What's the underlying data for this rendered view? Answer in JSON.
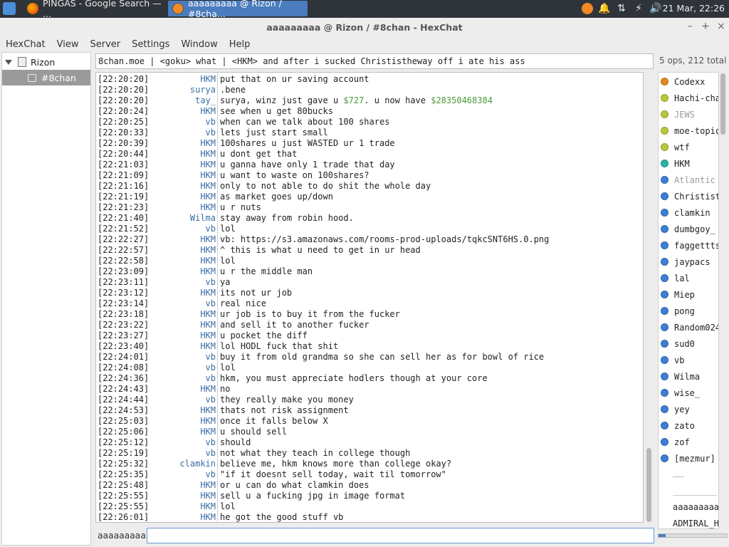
{
  "taskbar": {
    "tasks": [
      {
        "label": "PINGAS - Google Search — ..."
      },
      {
        "label": "aaaaaaaaa @ Rizon / #8cha..."
      }
    ],
    "clock": "21 Mar, 22:26"
  },
  "window": {
    "title": "aaaaaaaaa @ Rizon / #8chan - HexChat",
    "min": "–",
    "max": "+",
    "close": "×"
  },
  "menu": [
    "HexChat",
    "View",
    "Server",
    "Settings",
    "Window",
    "Help"
  ],
  "tree": {
    "server": "Rizon",
    "channel": "#8chan"
  },
  "topic": "8chan.moe | <goku> what | <HKM> and after i sucked Christistheway off i ate his ass",
  "ops_count": "5 ops, 212 total",
  "messages": [
    {
      "time": "[22:20:20]",
      "nick": "HKM",
      "text": "put that on ur saving account"
    },
    {
      "time": "[22:20:20]",
      "nick": "surya",
      "text": ".bene"
    },
    {
      "time": "[22:20:20]",
      "nick": "tay_",
      "text": "surya, winz just gave u ",
      "money1": "$727",
      "text2": ". u now have ",
      "money2": "$28350468384"
    },
    {
      "time": "[22:20:24]",
      "nick": "HKM",
      "text": "see when u get 80bucks"
    },
    {
      "time": "[22:20:25]",
      "nick": "vb",
      "text": "when can we talk about 100 shares"
    },
    {
      "time": "[22:20:33]",
      "nick": "vb",
      "text": "lets just start small"
    },
    {
      "time": "[22:20:39]",
      "nick": "HKM",
      "text": "100shares u just WASTED ur 1 trade"
    },
    {
      "time": "[22:20:44]",
      "nick": "HKM",
      "text": "u dont get that"
    },
    {
      "time": "[22:21:03]",
      "nick": "HKM",
      "text": "u ganna have only 1 trade that day"
    },
    {
      "time": "[22:21:09]",
      "nick": "HKM",
      "text": "u want to waste on 100shares?"
    },
    {
      "time": "[22:21:16]",
      "nick": "HKM",
      "text": "only to not able to do shit the whole day"
    },
    {
      "time": "[22:21:19]",
      "nick": "HKM",
      "text": "as market goes up/down"
    },
    {
      "time": "[22:21:23]",
      "nick": "HKM",
      "text": "u r nuts"
    },
    {
      "time": "[22:21:40]",
      "nick": "Wilma",
      "text": "stay away from robin hood."
    },
    {
      "time": "[22:21:52]",
      "nick": "vb",
      "text": "lol"
    },
    {
      "time": "[22:22:27]",
      "nick": "HKM",
      "text": "vb: https://s3.amazonaws.com/rooms-prod-uploads/tqkcSNT6HS.0.png"
    },
    {
      "time": "[22:22:57]",
      "nick": "HKM",
      "text": "^ this is what u need to get in ur head"
    },
    {
      "time": "[22:22:58]",
      "nick": "HKM",
      "text": "lol"
    },
    {
      "time": "[22:23:09]",
      "nick": "HKM",
      "text": "u r the middle man"
    },
    {
      "time": "[22:23:11]",
      "nick": "vb",
      "text": "ya"
    },
    {
      "time": "[22:23:12]",
      "nick": "HKM",
      "text": "its not ur job"
    },
    {
      "time": "[22:23:14]",
      "nick": "vb",
      "text": "real nice"
    },
    {
      "time": "[22:23:18]",
      "nick": "HKM",
      "text": "ur job is to buy it from the fucker"
    },
    {
      "time": "[22:23:22]",
      "nick": "HKM",
      "text": "and sell it to another fucker"
    },
    {
      "time": "[22:23:27]",
      "nick": "HKM",
      "text": "u pocket the diff"
    },
    {
      "time": "[22:23:40]",
      "nick": "HKM",
      "text": "lol HODL fuck that shit"
    },
    {
      "time": "[22:24:01]",
      "nick": "vb",
      "text": "buy it from old grandma so she can sell her as for bowl of rice"
    },
    {
      "time": "[22:24:08]",
      "nick": "vb",
      "text": "lol"
    },
    {
      "time": "[22:24:36]",
      "nick": "vb",
      "text": "hkm, you must appreciate hodlers though at your core"
    },
    {
      "time": "[22:24:43]",
      "nick": "HKM",
      "text": "no"
    },
    {
      "time": "[22:24:44]",
      "nick": "vb",
      "text": "they really make you money"
    },
    {
      "time": "[22:24:53]",
      "nick": "HKM",
      "text": "thats not risk assignment"
    },
    {
      "time": "[22:25:03]",
      "nick": "HKM",
      "text": "once it falls below X"
    },
    {
      "time": "[22:25:06]",
      "nick": "HKM",
      "text": "u should sell"
    },
    {
      "time": "[22:25:12]",
      "nick": "vb",
      "text": "should"
    },
    {
      "time": "[22:25:19]",
      "nick": "vb",
      "text": "not what they teach in college though"
    },
    {
      "time": "[22:25:32]",
      "nick": "clamkin",
      "text": "believe me, hkm knows more than college okay?"
    },
    {
      "time": "[22:25:35]",
      "nick": "vb",
      "text": "\"if it doesnt sell today, wait til tomorrow\""
    },
    {
      "time": "[22:25:48]",
      "nick": "HKM",
      "text": "or u can do what clamkin does"
    },
    {
      "time": "[22:25:55]",
      "nick": "HKM",
      "text": "sell u a fucking jpg in image format"
    },
    {
      "time": "[22:25:55]",
      "nick": "HKM",
      "text": "lol"
    },
    {
      "time": "[22:26:01]",
      "nick": "HKM",
      "text": "he got the good stuff vb"
    }
  ],
  "users": [
    {
      "name": "Codexx",
      "color": "#e08a1e"
    },
    {
      "name": "Hachi-chan",
      "color": "#b9c83a"
    },
    {
      "name": "JEWS",
      "color": "#b9c83a",
      "away": true
    },
    {
      "name": "moe-topic",
      "color": "#b9c83a"
    },
    {
      "name": "wtf",
      "color": "#b9c83a"
    },
    {
      "name": "HKM",
      "color": "#2bb3a3"
    },
    {
      "name": "Atlantic",
      "color": "#3d7fd6",
      "away": true
    },
    {
      "name": "Christistheway",
      "color": "#3d7fd6"
    },
    {
      "name": "clamkin",
      "color": "#3d7fd6"
    },
    {
      "name": "dumbgoy_",
      "color": "#3d7fd6"
    },
    {
      "name": "faggettts",
      "color": "#3d7fd6"
    },
    {
      "name": "jaypacs",
      "color": "#3d7fd6"
    },
    {
      "name": "lal",
      "color": "#3d7fd6"
    },
    {
      "name": "Miep",
      "color": "#3d7fd6"
    },
    {
      "name": "pong",
      "color": "#3d7fd6"
    },
    {
      "name": "Random024",
      "color": "#3d7fd6"
    },
    {
      "name": "sud0",
      "color": "#3d7fd6"
    },
    {
      "name": "vb",
      "color": "#3d7fd6"
    },
    {
      "name": "Wilma",
      "color": "#3d7fd6"
    },
    {
      "name": "wise_",
      "color": "#3d7fd6"
    },
    {
      "name": "yey",
      "color": "#3d7fd6"
    },
    {
      "name": "zato",
      "color": "#3d7fd6"
    },
    {
      "name": "zof",
      "color": "#3d7fd6"
    },
    {
      "name": "[mezmur]",
      "color": "#3d7fd6"
    }
  ],
  "users_extra": [
    "aaaaaaaaa",
    "ADMIRAL_H"
  ],
  "input": {
    "nick": "aaaaaaaaa",
    "value": ""
  },
  "colors": {
    "accent": "#4a7cbe",
    "nick": "#3a6ea5",
    "money": "#4a9a3a"
  }
}
